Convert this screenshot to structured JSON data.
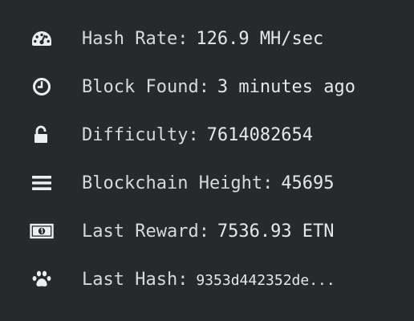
{
  "stats": [
    {
      "icon": "dashboard-gauge-icon",
      "label": "Hash Rate:",
      "value": "126.9 MH/sec"
    },
    {
      "icon": "clock-icon",
      "label": "Block Found:",
      "value": "3 minutes ago"
    },
    {
      "icon": "unlock-icon",
      "label": "Difficulty:",
      "value": "7614082654"
    },
    {
      "icon": "bars-icon",
      "label": "Blockchain Height:",
      "value": "45695"
    },
    {
      "icon": "money-icon",
      "label": "Last Reward:",
      "value": "7536.93 ETN"
    },
    {
      "icon": "paw-icon",
      "label": "Last Hash:",
      "value": "9353d442352de..."
    }
  ],
  "colors": {
    "background": "#27292c",
    "text": "#d7d9dc",
    "icon": "#eceef0"
  }
}
